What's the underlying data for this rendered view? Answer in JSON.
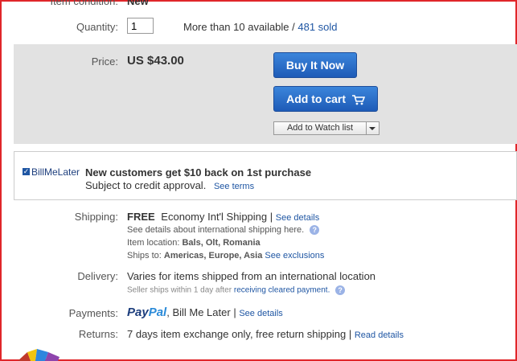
{
  "item_condition": {
    "label": "Item condition:",
    "value": "New"
  },
  "quantity": {
    "label": "Quantity:",
    "input_value": "1",
    "available_text": "More than 10 available",
    "separator": " / ",
    "sold_link": "481 sold"
  },
  "price": {
    "label": "Price:",
    "value": "US $43.00"
  },
  "buttons": {
    "buy_it_now": "Buy It Now",
    "add_to_cart": "Add to cart",
    "watch_list": "Add to Watch list"
  },
  "bill_me_later": {
    "logo_text": "BillMeLater",
    "headline": "New customers get $10 back on 1st purchase",
    "subtext": "Subject to credit approval.",
    "terms_link": "See terms"
  },
  "shipping": {
    "label": "Shipping:",
    "free": "FREE",
    "method": "Economy Int'l Shipping",
    "pipe": "|",
    "details_link": "See details",
    "intl_text": "See details about international shipping here.",
    "location_label": "Item location:",
    "location_value": "Bals, Olt, Romania",
    "ships_to_label": "Ships to:",
    "ships_to_value": "Americas, Europe, Asia",
    "exclusions_link": "See exclusions"
  },
  "delivery": {
    "label": "Delivery:",
    "value": "Varies for items shipped from an international location",
    "note": "Seller ships within 1 day after",
    "note_link": "receiving cleared payment."
  },
  "payments": {
    "label": "Payments:",
    "paypal_pay": "Pay",
    "paypal_pal": "Pal",
    "value": ", Bill Me Later",
    "pipe": "|",
    "details_link": "See details"
  },
  "returns": {
    "label": "Returns:",
    "value": "7 days item exchange only, free return shipping",
    "pipe": "|",
    "details_link": "Read details"
  },
  "colors": {
    "link": "#1f56a3",
    "button": "#1e5bb7",
    "panel": "#e2e2e2",
    "border": "#e0262a"
  }
}
